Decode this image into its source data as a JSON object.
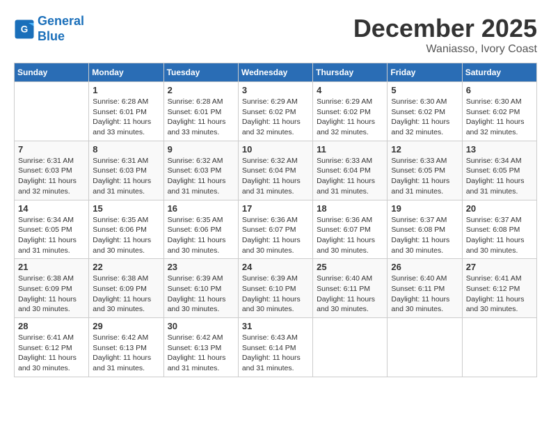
{
  "header": {
    "logo_line1": "General",
    "logo_line2": "Blue",
    "month": "December 2025",
    "location": "Waniasso, Ivory Coast"
  },
  "weekdays": [
    "Sunday",
    "Monday",
    "Tuesday",
    "Wednesday",
    "Thursday",
    "Friday",
    "Saturday"
  ],
  "weeks": [
    [
      {
        "day": "",
        "sunrise": "",
        "sunset": "",
        "daylight": ""
      },
      {
        "day": "1",
        "sunrise": "Sunrise: 6:28 AM",
        "sunset": "Sunset: 6:01 PM",
        "daylight": "Daylight: 11 hours and 33 minutes."
      },
      {
        "day": "2",
        "sunrise": "Sunrise: 6:28 AM",
        "sunset": "Sunset: 6:01 PM",
        "daylight": "Daylight: 11 hours and 33 minutes."
      },
      {
        "day": "3",
        "sunrise": "Sunrise: 6:29 AM",
        "sunset": "Sunset: 6:02 PM",
        "daylight": "Daylight: 11 hours and 32 minutes."
      },
      {
        "day": "4",
        "sunrise": "Sunrise: 6:29 AM",
        "sunset": "Sunset: 6:02 PM",
        "daylight": "Daylight: 11 hours and 32 minutes."
      },
      {
        "day": "5",
        "sunrise": "Sunrise: 6:30 AM",
        "sunset": "Sunset: 6:02 PM",
        "daylight": "Daylight: 11 hours and 32 minutes."
      },
      {
        "day": "6",
        "sunrise": "Sunrise: 6:30 AM",
        "sunset": "Sunset: 6:02 PM",
        "daylight": "Daylight: 11 hours and 32 minutes."
      }
    ],
    [
      {
        "day": "7",
        "sunrise": "Sunrise: 6:31 AM",
        "sunset": "Sunset: 6:03 PM",
        "daylight": "Daylight: 11 hours and 32 minutes."
      },
      {
        "day": "8",
        "sunrise": "Sunrise: 6:31 AM",
        "sunset": "Sunset: 6:03 PM",
        "daylight": "Daylight: 11 hours and 31 minutes."
      },
      {
        "day": "9",
        "sunrise": "Sunrise: 6:32 AM",
        "sunset": "Sunset: 6:03 PM",
        "daylight": "Daylight: 11 hours and 31 minutes."
      },
      {
        "day": "10",
        "sunrise": "Sunrise: 6:32 AM",
        "sunset": "Sunset: 6:04 PM",
        "daylight": "Daylight: 11 hours and 31 minutes."
      },
      {
        "day": "11",
        "sunrise": "Sunrise: 6:33 AM",
        "sunset": "Sunset: 6:04 PM",
        "daylight": "Daylight: 11 hours and 31 minutes."
      },
      {
        "day": "12",
        "sunrise": "Sunrise: 6:33 AM",
        "sunset": "Sunset: 6:05 PM",
        "daylight": "Daylight: 11 hours and 31 minutes."
      },
      {
        "day": "13",
        "sunrise": "Sunrise: 6:34 AM",
        "sunset": "Sunset: 6:05 PM",
        "daylight": "Daylight: 11 hours and 31 minutes."
      }
    ],
    [
      {
        "day": "14",
        "sunrise": "Sunrise: 6:34 AM",
        "sunset": "Sunset: 6:05 PM",
        "daylight": "Daylight: 11 hours and 31 minutes."
      },
      {
        "day": "15",
        "sunrise": "Sunrise: 6:35 AM",
        "sunset": "Sunset: 6:06 PM",
        "daylight": "Daylight: 11 hours and 30 minutes."
      },
      {
        "day": "16",
        "sunrise": "Sunrise: 6:35 AM",
        "sunset": "Sunset: 6:06 PM",
        "daylight": "Daylight: 11 hours and 30 minutes."
      },
      {
        "day": "17",
        "sunrise": "Sunrise: 6:36 AM",
        "sunset": "Sunset: 6:07 PM",
        "daylight": "Daylight: 11 hours and 30 minutes."
      },
      {
        "day": "18",
        "sunrise": "Sunrise: 6:36 AM",
        "sunset": "Sunset: 6:07 PM",
        "daylight": "Daylight: 11 hours and 30 minutes."
      },
      {
        "day": "19",
        "sunrise": "Sunrise: 6:37 AM",
        "sunset": "Sunset: 6:08 PM",
        "daylight": "Daylight: 11 hours and 30 minutes."
      },
      {
        "day": "20",
        "sunrise": "Sunrise: 6:37 AM",
        "sunset": "Sunset: 6:08 PM",
        "daylight": "Daylight: 11 hours and 30 minutes."
      }
    ],
    [
      {
        "day": "21",
        "sunrise": "Sunrise: 6:38 AM",
        "sunset": "Sunset: 6:09 PM",
        "daylight": "Daylight: 11 hours and 30 minutes."
      },
      {
        "day": "22",
        "sunrise": "Sunrise: 6:38 AM",
        "sunset": "Sunset: 6:09 PM",
        "daylight": "Daylight: 11 hours and 30 minutes."
      },
      {
        "day": "23",
        "sunrise": "Sunrise: 6:39 AM",
        "sunset": "Sunset: 6:10 PM",
        "daylight": "Daylight: 11 hours and 30 minutes."
      },
      {
        "day": "24",
        "sunrise": "Sunrise: 6:39 AM",
        "sunset": "Sunset: 6:10 PM",
        "daylight": "Daylight: 11 hours and 30 minutes."
      },
      {
        "day": "25",
        "sunrise": "Sunrise: 6:40 AM",
        "sunset": "Sunset: 6:11 PM",
        "daylight": "Daylight: 11 hours and 30 minutes."
      },
      {
        "day": "26",
        "sunrise": "Sunrise: 6:40 AM",
        "sunset": "Sunset: 6:11 PM",
        "daylight": "Daylight: 11 hours and 30 minutes."
      },
      {
        "day": "27",
        "sunrise": "Sunrise: 6:41 AM",
        "sunset": "Sunset: 6:12 PM",
        "daylight": "Daylight: 11 hours and 30 minutes."
      }
    ],
    [
      {
        "day": "28",
        "sunrise": "Sunrise: 6:41 AM",
        "sunset": "Sunset: 6:12 PM",
        "daylight": "Daylight: 11 hours and 30 minutes."
      },
      {
        "day": "29",
        "sunrise": "Sunrise: 6:42 AM",
        "sunset": "Sunset: 6:13 PM",
        "daylight": "Daylight: 11 hours and 31 minutes."
      },
      {
        "day": "30",
        "sunrise": "Sunrise: 6:42 AM",
        "sunset": "Sunset: 6:13 PM",
        "daylight": "Daylight: 11 hours and 31 minutes."
      },
      {
        "day": "31",
        "sunrise": "Sunrise: 6:43 AM",
        "sunset": "Sunset: 6:14 PM",
        "daylight": "Daylight: 11 hours and 31 minutes."
      },
      {
        "day": "",
        "sunrise": "",
        "sunset": "",
        "daylight": ""
      },
      {
        "day": "",
        "sunrise": "",
        "sunset": "",
        "daylight": ""
      },
      {
        "day": "",
        "sunrise": "",
        "sunset": "",
        "daylight": ""
      }
    ]
  ]
}
